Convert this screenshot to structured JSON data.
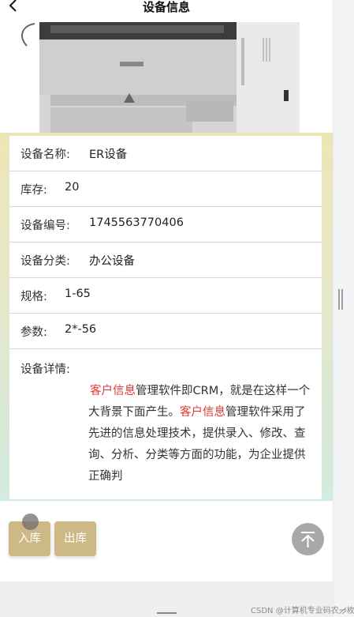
{
  "header": {
    "title": "设备信息"
  },
  "device": {
    "name_label": "设备名称:",
    "name_value": "ER设备",
    "stock_label": "库存:",
    "stock_value": "20",
    "code_label": "设备编号:",
    "code_value": "1745563770406",
    "category_label": "设备分类:",
    "category_value": "办公设备",
    "spec_label": "规格:",
    "spec_value": "1-65",
    "param_label": "参数:",
    "param_value": "2*-56",
    "detail_label": "设备详情:",
    "detail_parts": [
      "客户信息",
      "管理软件即CRM，就是在这样一个大背景下面产生。",
      "客户信息",
      "管理软件采用了先进的信息处理技术，提供录入、修改、查询、分析、分类等方面的功能，为企业提供正确判"
    ]
  },
  "actions": {
    "in_label": "入库",
    "out_label": "出库"
  },
  "watermark": "CSDN @计算机专业码农一枚",
  "colors": {
    "accent": "#cdb985",
    "highlight": "#e33535"
  }
}
